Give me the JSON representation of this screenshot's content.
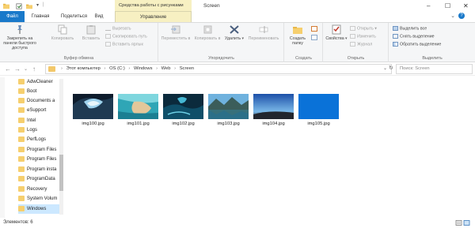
{
  "titlebar": {
    "context_label": "Средства работы с рисунками",
    "title": "Screen",
    "controls": [
      "–",
      "☐",
      "✕"
    ]
  },
  "tabs": [
    {
      "label": "Файл"
    },
    {
      "label": "Главная"
    },
    {
      "label": "Поделиться"
    },
    {
      "label": "Вид"
    },
    {
      "label": "Управление"
    }
  ],
  "ribbon": {
    "clipboard": {
      "pin": "Закрепить на панели быстрого доступа",
      "copy": "Копировать",
      "paste": "Вставить",
      "cut": "Вырезать",
      "copy_path": "Скопировать путь",
      "paste_shortcut": "Вставить ярлык",
      "group": "Буфер обмена"
    },
    "organize": {
      "move_to": "Переместить в",
      "copy_to": "Копировать в",
      "delete": "Удалить",
      "rename": "Переименовать",
      "group": "Упорядочить"
    },
    "create": {
      "new_folder": "Создать папку",
      "group": "Создать"
    },
    "open": {
      "properties": "Свойства",
      "open": "Открыть",
      "edit": "Изменить",
      "history": "Журнал",
      "group": "Открыть"
    },
    "select": {
      "select_all": "Выделить все",
      "select_none": "Снять выделение",
      "invert": "Обратить выделение",
      "group": "Выделить"
    }
  },
  "address": {
    "crumbs": [
      "Этот компьютер",
      "OS (C:)",
      "Windows",
      "Web",
      "Screen"
    ],
    "search_placeholder": "Поиск: Screen"
  },
  "tree": [
    {
      "label": "AdwCleaner"
    },
    {
      "label": "Boot"
    },
    {
      "label": "Documents a"
    },
    {
      "label": "eSupport"
    },
    {
      "label": "Intel"
    },
    {
      "label": "Logs"
    },
    {
      "label": "PerfLogs"
    },
    {
      "label": "Program Files"
    },
    {
      "label": "Program Files"
    },
    {
      "label": "Program insta"
    },
    {
      "label": "ProgramData"
    },
    {
      "label": "Recovery"
    },
    {
      "label": "System Volum"
    },
    {
      "label": "Windows"
    }
  ],
  "files": [
    {
      "name": "img100.jpg"
    },
    {
      "name": "img101.jpg"
    },
    {
      "name": "img102.jpg"
    },
    {
      "name": "img103.jpg"
    },
    {
      "name": "img104.jpg"
    },
    {
      "name": "img105.jpg"
    }
  ],
  "status": {
    "count_label": "Элементов: 6"
  },
  "colors": {
    "accent": "#1979ca",
    "context": "#f7f0c2",
    "folder": "#f6cf6e",
    "selection": "#cce8ff"
  }
}
